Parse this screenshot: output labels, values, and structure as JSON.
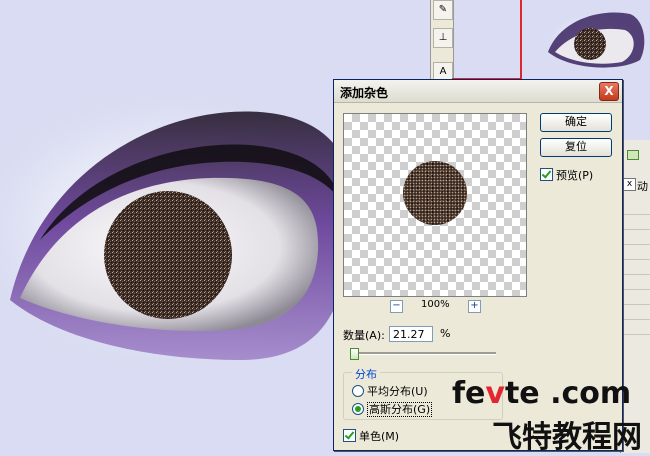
{
  "dialog": {
    "title": "添加杂色",
    "ok_label": "确定",
    "reset_label": "复位",
    "preview_label": "预览(P)",
    "preview_checked": true,
    "zoom_level": "100%",
    "zoom_out_label": "−",
    "zoom_in_label": "+",
    "amount_label": "数量(A):",
    "amount_value": "21.27",
    "amount_unit": "%",
    "distribution_label": "分布",
    "distribution_options": [
      "平均分布(U)",
      "高斯分布(G)"
    ],
    "distribution_selected": "高斯分布(G)",
    "monochrome_label": "单色(M)",
    "monochrome_checked": true,
    "close_label": "X"
  },
  "toolbox": {
    "tools": [
      "brush-icon",
      "stamp-icon",
      "type-icon"
    ],
    "type_tool_label": "A"
  },
  "right_panel": {
    "tab_close": "x",
    "tab_label": "动"
  },
  "watermark": {
    "line1_a": "fe",
    "line1_b": "v",
    "line1_c": "te .com",
    "line2": "飞特教程网"
  },
  "colors": {
    "dialog_bg": "#ece9d8",
    "title_close": "#c5391c",
    "eye_shadow": "#5a2d8c",
    "accent_green": "#21a121",
    "watermark_red": "#e3262f"
  }
}
